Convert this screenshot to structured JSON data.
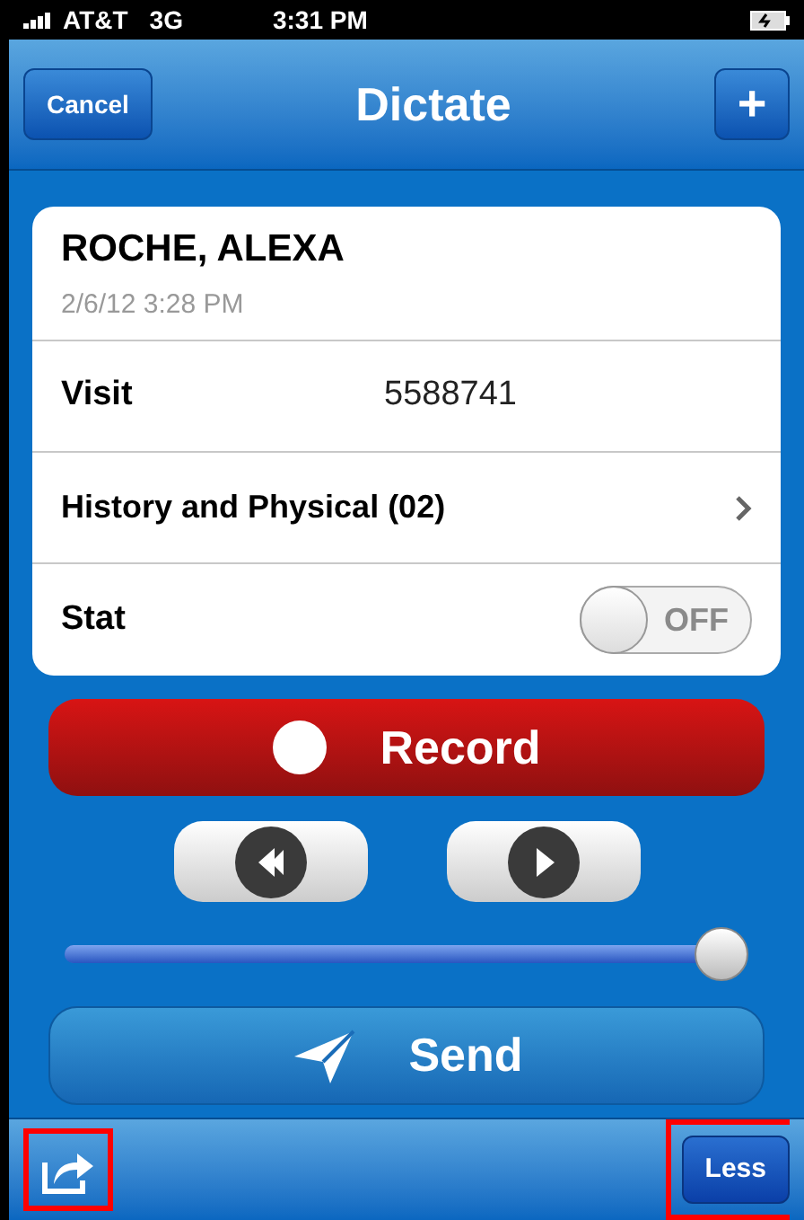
{
  "status_bar": {
    "carrier": "AT&T",
    "network": "3G",
    "time": "3:31 PM"
  },
  "nav_bar": {
    "left_button": "Cancel",
    "title": "Dictate",
    "right_button": "+"
  },
  "patient": {
    "name": "ROCHE, ALEXA",
    "datetime": "2/6/12 3:28 PM"
  },
  "rows": [
    {
      "kind": "value",
      "label": "Visit",
      "value": "5588741"
    },
    {
      "kind": "link",
      "label": "History and Physical (02)"
    },
    {
      "kind": "switch",
      "label": "Stat",
      "on": false,
      "off_text": "OFF"
    }
  ],
  "record_button": "Record",
  "playback": {
    "level": 0.96
  },
  "send_button": "Send",
  "toolbar": {
    "share": {
      "highlighted": true
    },
    "right_button": {
      "label": "Less",
      "highlighted": true
    }
  }
}
